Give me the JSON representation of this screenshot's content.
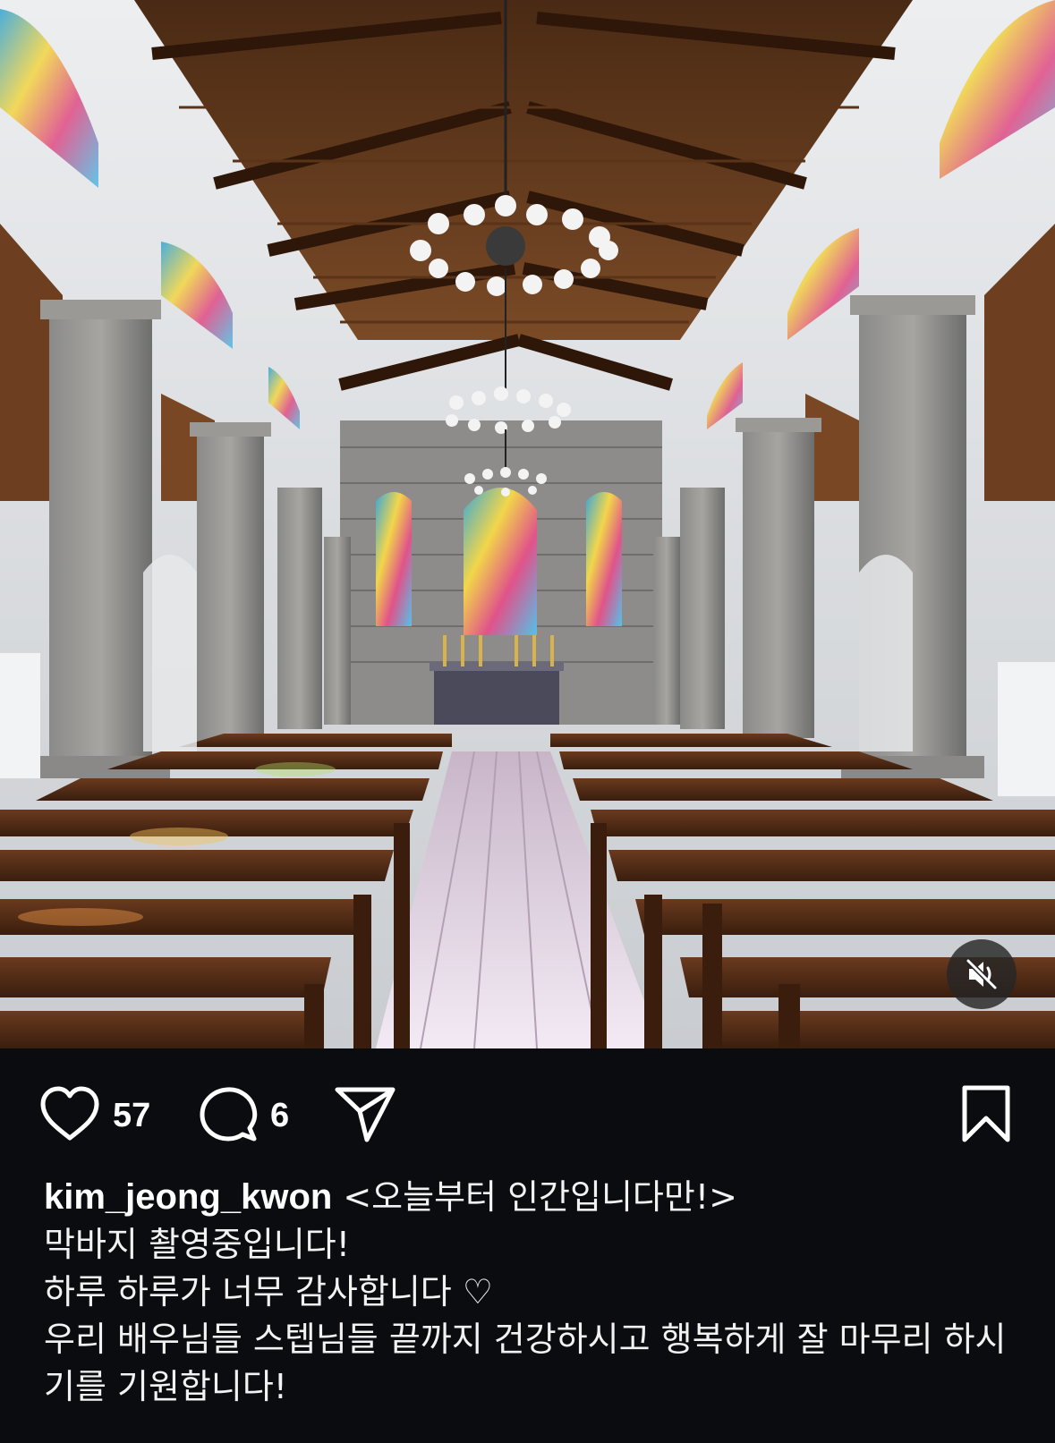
{
  "post": {
    "likes_count": "57",
    "comments_count": "6",
    "username": "kim_jeong_kwon",
    "caption_lines": [
      "<오늘부터 인간입니다만!>",
      "막바지 촬영중입니다!",
      "하루 하루가 너무 감사합니다 ♡",
      "우리 배우님들 스텝님들 끝까지 건강하시고 행복하게 잘 마무리 하시기를 기원합니다!"
    ]
  },
  "icons": {
    "like": "heart-icon",
    "comment": "comment-bubble-icon",
    "share": "paper-plane-icon",
    "save": "bookmark-icon",
    "mute": "speaker-muted-icon"
  },
  "colors": {
    "background": "#0b0c10",
    "text": "#ffffff",
    "mute_button_bg": "#262626"
  }
}
